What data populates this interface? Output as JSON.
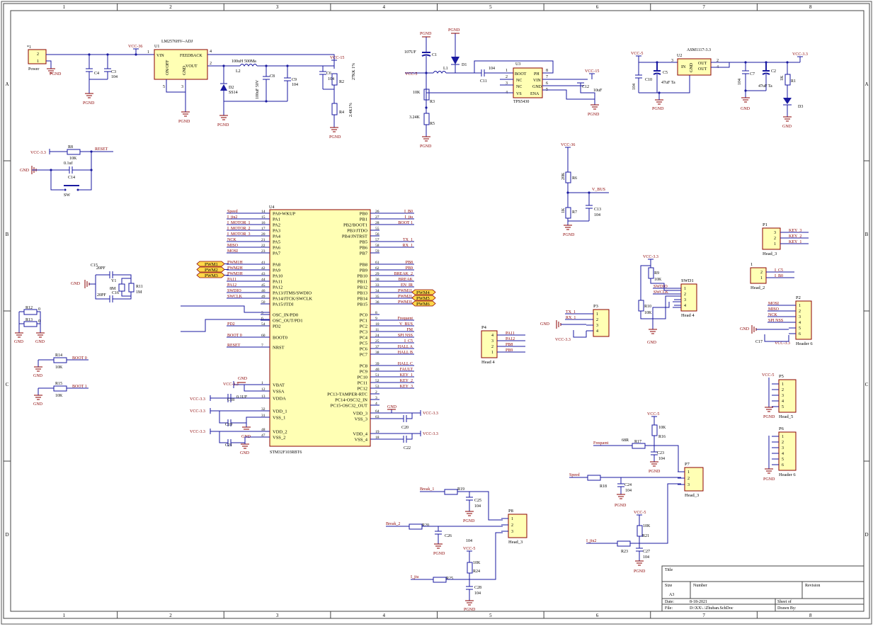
{
  "frame": {
    "cols": [
      "1",
      "2",
      "3",
      "4",
      "5",
      "6",
      "7",
      "8"
    ],
    "rows": [
      "A",
      "B",
      "C",
      "D"
    ]
  },
  "title_block": {
    "title_label": "Title",
    "size_label": "Size",
    "size_value": "A3",
    "number_label": "Number",
    "revision_label": "Revision",
    "date_label": "Date:",
    "date_value": "8-18-2021",
    "sheet_label": "Sheet  of",
    "file_label": "File:",
    "file_value": "D:\\XX\\..\\Zhuban.SchDoc",
    "drawn_label": "Drawn By:"
  },
  "power": {
    "ref": "*1",
    "name": "Power",
    "p1": "1",
    "p2": "2",
    "gnd": "PGND"
  },
  "lm2576": {
    "ref": "U1",
    "name": "LM2576HV--ADJ",
    "vin": "VIN",
    "feedback": "FEEDBACK",
    "vout": "VOUT",
    "onoff": "ON/OFF",
    "gndpin": "GND",
    "p1": "1",
    "p2": "2",
    "p3": "3",
    "p4": "4",
    "p5": "5"
  },
  "nets": {
    "vcc36": "VCC-36",
    "vcc15": "VCC-15",
    "vcc5": "VCC-5",
    "vcc33": "VCC-3.3",
    "pgnd": "PGND",
    "gnd": "GND",
    "gnd2": "GND",
    "vbus": "V_BUS",
    "reset": "RESET",
    "boot0": "BOOT 0",
    "boot1": "BOOT 1"
  },
  "c4": "C4",
  "c3": "C3",
  "c3v": "104",
  "l2": "L2",
  "l2v": "100uH 500Ma",
  "d2": "D2",
  "d2v": "SS14",
  "c8": "C8",
  "c8v": "100uF 50V",
  "c9": "C9",
  "c9v": "104",
  "c6": "C6",
  "c6v": "104",
  "r2": "R2",
  "r2v": "27KK 1%",
  "r4": "R4",
  "r4v": "2.4K1%",
  "tps": {
    "ref": "U3",
    "name": "TPS5430",
    "boot": "BOOT",
    "ph": "PH",
    "nc1": "NC",
    "nc2": "NC",
    "vin": "VIN",
    "gndp": "GND",
    "vs": "VS",
    "ena": "ENA",
    "p1": "1",
    "p2": "2",
    "p3": "3",
    "p4": "4",
    "p5": "5",
    "p6": "6",
    "p7": "7",
    "p8": "8"
  },
  "c1": "C1",
  "c1v": "107UF",
  "d1": "D1",
  "l1": "L1",
  "c11": "C11",
  "c11v": "104",
  "r3": "R3",
  "r3v": "10K",
  "r5": "R5",
  "r5v": "3.24K",
  "c12": "C12",
  "c12v": "10uF",
  "asm": {
    "ref": "U2",
    "name": "ASM1117-3.3",
    "in": "IN",
    "out1": "OUT",
    "out2": "OUT",
    "gndp": "GND",
    "p2": "2",
    "p3": "3",
    "p4": "4"
  },
  "c10": "C10",
  "c10v": "104",
  "c5": "C5",
  "c5v": "47uF Ta",
  "c7": "C7",
  "c7v": "104",
  "c2": "C2",
  "c2v": "47uF Ta",
  "r1": "R1",
  "r1v": "1K",
  "d3": "D3",
  "reset": {
    "r8": "R8",
    "r8v": "10K",
    "c14": "C14",
    "c14v": "0.1uf",
    "sw": "SW"
  },
  "vbus": {
    "r6": "R6",
    "r6v": "20K",
    "r7": "R7",
    "r7v": "1K",
    "c13": "C13",
    "c13v": "104"
  },
  "xtal": {
    "c15": "C15",
    "c15v": "20PF",
    "c16": "C16",
    "c16v": "20PF",
    "y1": "Y1",
    "y1v": "8M",
    "r11": "R11",
    "r11v": "1M"
  },
  "misc": {
    "r12": "R12",
    "r12v": "0",
    "r13": "R13",
    "r13v": "0",
    "r14": "R14",
    "r14v": "10K",
    "r15": "R15",
    "r15v": "10K"
  },
  "mcu": {
    "ref": "U4",
    "name": "STM32F103RBT6",
    "left_pins": [
      {
        "n": "14",
        "p": "PA0-WKUP",
        "net": "Speed"
      },
      {
        "n": "15",
        "p": "PA1",
        "net": "I_jiu2"
      },
      {
        "n": "16",
        "p": "PA2",
        "net": "I_MOTOR_1"
      },
      {
        "n": "17",
        "p": "PA3",
        "net": "I_MOTOR_2"
      },
      {
        "n": "20",
        "p": "PA4",
        "net": "I_MOTOR_3"
      },
      {
        "n": "21",
        "p": "PA5",
        "net": "NCK"
      },
      {
        "n": "22",
        "p": "PA6",
        "net": "MISO"
      },
      {
        "n": "23",
        "p": "PA7",
        "net": "MOSI"
      },
      {
        "n": "41",
        "p": "PA8",
        "net": "PWM1H"
      },
      {
        "n": "42",
        "p": "PA9",
        "net": "PWM2H"
      },
      {
        "n": "43",
        "p": "PA10",
        "net": "PWM3H"
      },
      {
        "n": "44",
        "p": "PA11",
        "net": "PA11"
      },
      {
        "n": "45",
        "p": "PA12",
        "net": "PA12"
      },
      {
        "n": "46",
        "p": "PA13/JTMS/SWDIO",
        "net": "SWDIO"
      },
      {
        "n": "49",
        "p": "PA14/JTCK/SWCLK",
        "net": "SWCLK"
      },
      {
        "n": "50",
        "p": "PA15/JTDI",
        "net": ""
      },
      {
        "n": "5",
        "p": "OSC_IN/PD0",
        "net": ""
      },
      {
        "n": "6",
        "p": "OSC_OUT/PD1",
        "net": ""
      },
      {
        "n": "54",
        "p": "PD2",
        "net": "PD2"
      },
      {
        "n": "60",
        "p": "BOOT0",
        "net": "BOOT 0"
      },
      {
        "n": "7",
        "p": "NRST",
        "net": "RESET"
      },
      {
        "n": "1",
        "p": "VBAT",
        "net": ""
      },
      {
        "n": "12",
        "p": "VSSA",
        "net": ""
      },
      {
        "n": "13",
        "p": "VDDA",
        "net": "VCC-3.3"
      },
      {
        "n": "32",
        "p": "VDD_1",
        "net": "VCC-3.3"
      },
      {
        "n": "31",
        "p": "VSS_1",
        "net": ""
      },
      {
        "n": "48",
        "p": "VDD_2",
        "net": "VCC-3.3"
      },
      {
        "n": "47",
        "p": "VSS_2",
        "net": ""
      }
    ],
    "right_pins": [
      {
        "n": "26",
        "p": "PB0",
        "net": "I_B0"
      },
      {
        "n": "27",
        "p": "PB1",
        "net": "I_jiu"
      },
      {
        "n": "28",
        "p": "PB2/BOOT1",
        "net": "BOOT 1"
      },
      {
        "n": "55",
        "p": "PB3/JTDO",
        "net": ""
      },
      {
        "n": "56",
        "p": "PB4/JNTRST",
        "net": ""
      },
      {
        "n": "57",
        "p": "PB5",
        "net": "TX_1"
      },
      {
        "n": "58",
        "p": "PB6",
        "net": "RX_1"
      },
      {
        "n": "59",
        "p": "PB7",
        "net": ""
      },
      {
        "n": "61",
        "p": "PB8",
        "net": "PB8"
      },
      {
        "n": "62",
        "p": "PB9",
        "net": "PB9"
      },
      {
        "n": "29",
        "p": "PB10",
        "net": "BREAK_2"
      },
      {
        "n": "30",
        "p": "PB11",
        "net": "BREAK"
      },
      {
        "n": "33",
        "p": "PB12",
        "net": "EN_IR"
      },
      {
        "n": "34",
        "p": "PB13",
        "net": "PWM1L"
      },
      {
        "n": "35",
        "p": "PB14",
        "net": "PWM2L"
      },
      {
        "n": "36",
        "p": "PB15",
        "net": "PWM3L"
      },
      {
        "n": "8",
        "p": "PC0",
        "net": ""
      },
      {
        "n": "9",
        "p": "PC1",
        "net": "Frequent"
      },
      {
        "n": "10",
        "p": "PC2",
        "net": "V_BUS"
      },
      {
        "n": "11",
        "p": "PC3",
        "net": "FM"
      },
      {
        "n": "24",
        "p": "PC4",
        "net": "SPI NSS"
      },
      {
        "n": "25",
        "p": "PC5",
        "net": "I_C5"
      },
      {
        "n": "37",
        "p": "PC6",
        "net": "HALL A"
      },
      {
        "n": "38",
        "p": "PC7",
        "net": "HALL B"
      },
      {
        "n": "39",
        "p": "PC8",
        "net": "HALL C"
      },
      {
        "n": "40",
        "p": "PC9",
        "net": "FAULT"
      },
      {
        "n": "51",
        "p": "PC10",
        "net": "KEY_1"
      },
      {
        "n": "52",
        "p": "PC11",
        "net": "KEY_2"
      },
      {
        "n": "53",
        "p": "PC12",
        "net": "KEY_3"
      },
      {
        "n": "2",
        "p": "PC13-TAMPER-RTC",
        "net": ""
      },
      {
        "n": "3",
        "p": "PC14-OSC32_IN",
        "net": ""
      },
      {
        "n": "4",
        "p": "PC15-OSC32_OUT",
        "net": ""
      },
      {
        "n": "64",
        "p": "VDD_3",
        "net": "VCC-3.3"
      },
      {
        "n": "63",
        "p": "VSS_3",
        "net": ""
      },
      {
        "n": "19",
        "p": "VDD_4",
        "net": "VCC-3.3"
      },
      {
        "n": "18",
        "p": "VSS_4",
        "net": ""
      }
    ],
    "pwm_left": [
      "PWM1",
      "PWM2",
      "PWM3"
    ],
    "pwm_right": [
      "PWM4",
      "PWM5",
      "PWM6"
    ],
    "c18": "C18",
    "c18v": "0.1UF",
    "c19": "C19",
    "c21": "C21",
    "c20": "C20",
    "c22": "C22"
  },
  "p1": {
    "ref": "P1",
    "name": "Head_3",
    "pins": [
      "3",
      "2",
      "1"
    ],
    "nets": [
      "KEY_3",
      "KEY_2",
      "KEY_1"
    ]
  },
  "jp": {
    "ref": "1",
    "name": "Head_2",
    "pins": [
      "2",
      "1"
    ],
    "nets": [
      "I_C5",
      "I_B0"
    ]
  },
  "swd": {
    "ref": "SWD1",
    "name": "Head 4",
    "pins": [
      "1",
      "2",
      "3",
      "4"
    ],
    "nets": [
      "SWDIO",
      "SWCLK"
    ],
    "r9": "R9",
    "r9v": "10K",
    "r10": "R10",
    "r10v": "10K"
  },
  "p2": {
    "ref": "P2",
    "name": "Header 6",
    "pins": [
      "1",
      "2",
      "3",
      "4",
      "5",
      "6"
    ],
    "nets": [
      "MOSI",
      "MISO",
      "NCK",
      "SPI NSS"
    ],
    "c17": "C17"
  },
  "p3": {
    "ref": "P3",
    "name": "",
    "pins": [
      "1",
      "2",
      "3",
      "4"
    ],
    "nets": [
      "TX_1",
      "RX_1"
    ]
  },
  "p4": {
    "ref": "P4",
    "name": "Head 4",
    "pins": [
      "4",
      "3",
      "2",
      "1"
    ],
    "nets": [
      "PA11",
      "PA12",
      "PB8",
      "PB9"
    ]
  },
  "p5": {
    "ref": "P5",
    "name": "Head_5",
    "pins": [
      "1",
      "2",
      "3",
      "4",
      "5"
    ]
  },
  "p6": {
    "ref": "P6",
    "name": "Header 6",
    "pins": [
      "1",
      "2",
      "3",
      "4",
      "5",
      "6"
    ]
  },
  "p7": {
    "ref": "P7",
    "name": "Head_3",
    "pins": [
      "1",
      "2",
      "3"
    ]
  },
  "p8": {
    "ref": "P8",
    "name": "Head_3",
    "pins": [
      "1",
      "2",
      "3"
    ]
  },
  "sensors": {
    "freq": "Frequent",
    "r17": "R17",
    "r17v": "68R",
    "r16": "R16",
    "r16v": "10K",
    "c23": "C23",
    "c23v": "104",
    "speed": "Speed",
    "r18": "R18",
    "c24": "C24",
    "c24v": "104",
    "jiu2": "I_jiu2",
    "r23": "R23",
    "r21": "R21",
    "r21v": "10K",
    "c27": "C27",
    "c27v": "104",
    "break1": "Break_1",
    "r19": "R19",
    "c25": "C25",
    "c25v": "104",
    "break2": "Break_2",
    "r20": "R20",
    "c26": "C26",
    "c26v": "104",
    "jiu": "I_jiu",
    "r25": "R25",
    "r24": "R24",
    "r24v": "10K",
    "c28": "C28",
    "c28v": "104"
  }
}
